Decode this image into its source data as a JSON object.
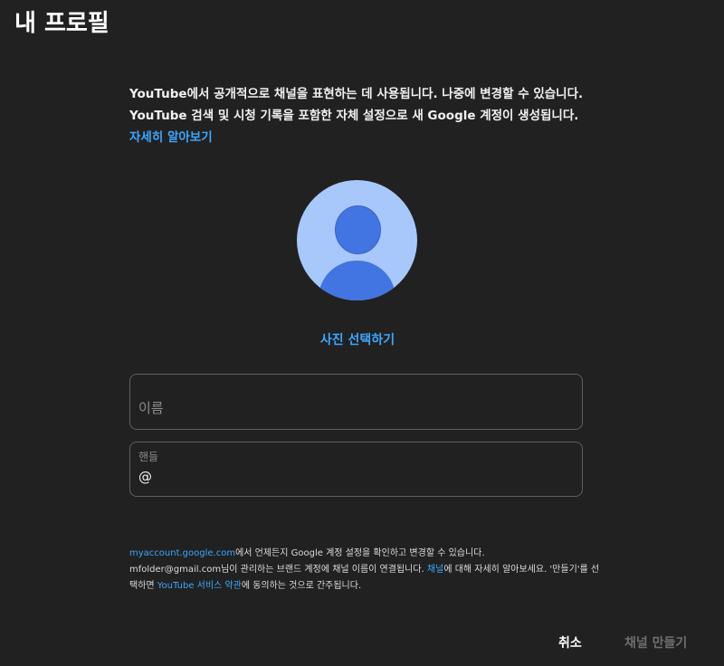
{
  "dialog": {
    "title": "내 프로필"
  },
  "intro": {
    "text": "YouTube에서 공개적으로 채널을 표현하는 데 사용됩니다. 나중에 변경할 수 있습니다. YouTube 검색 및 시청 기록을 포함한 자체 설정으로 새 Google 계정이 생성됩니다. ",
    "learn_more": "자세히 알아보기"
  },
  "avatar": {
    "icon": "default-profile-avatar-icon",
    "bg_color": "#a8c7fa",
    "fg_color": "#4274e2"
  },
  "photo": {
    "select_label": "사진 선택하기"
  },
  "name_field": {
    "placeholder": "이름",
    "value": ""
  },
  "handle_field": {
    "label": "핸들",
    "prefix": "@",
    "value": ""
  },
  "fine_print": {
    "line1_link": "myaccount.google.com",
    "line1_text": "에서 언제든지 Google 계정 설정을 확인하고 변경할 수 있습니다.",
    "line2_text_a": "mfolder@gmail.com님이 관리하는 브랜드 계정에 채널 이름이 연결됩니다. ",
    "line2_link": "채널",
    "line2_text_b": "에 대해 자세히 알아보세요. '만들기'를 선택하면 ",
    "line2_link2": "YouTube 서비스 약관",
    "line2_text_c": "에 동의하는 것으로 간주됩니다."
  },
  "buttons": {
    "cancel": "취소",
    "create": "채널 만들기"
  },
  "colors": {
    "background": "#212121",
    "link": "#3ea6ff",
    "disabled": "#6f6f6f"
  }
}
